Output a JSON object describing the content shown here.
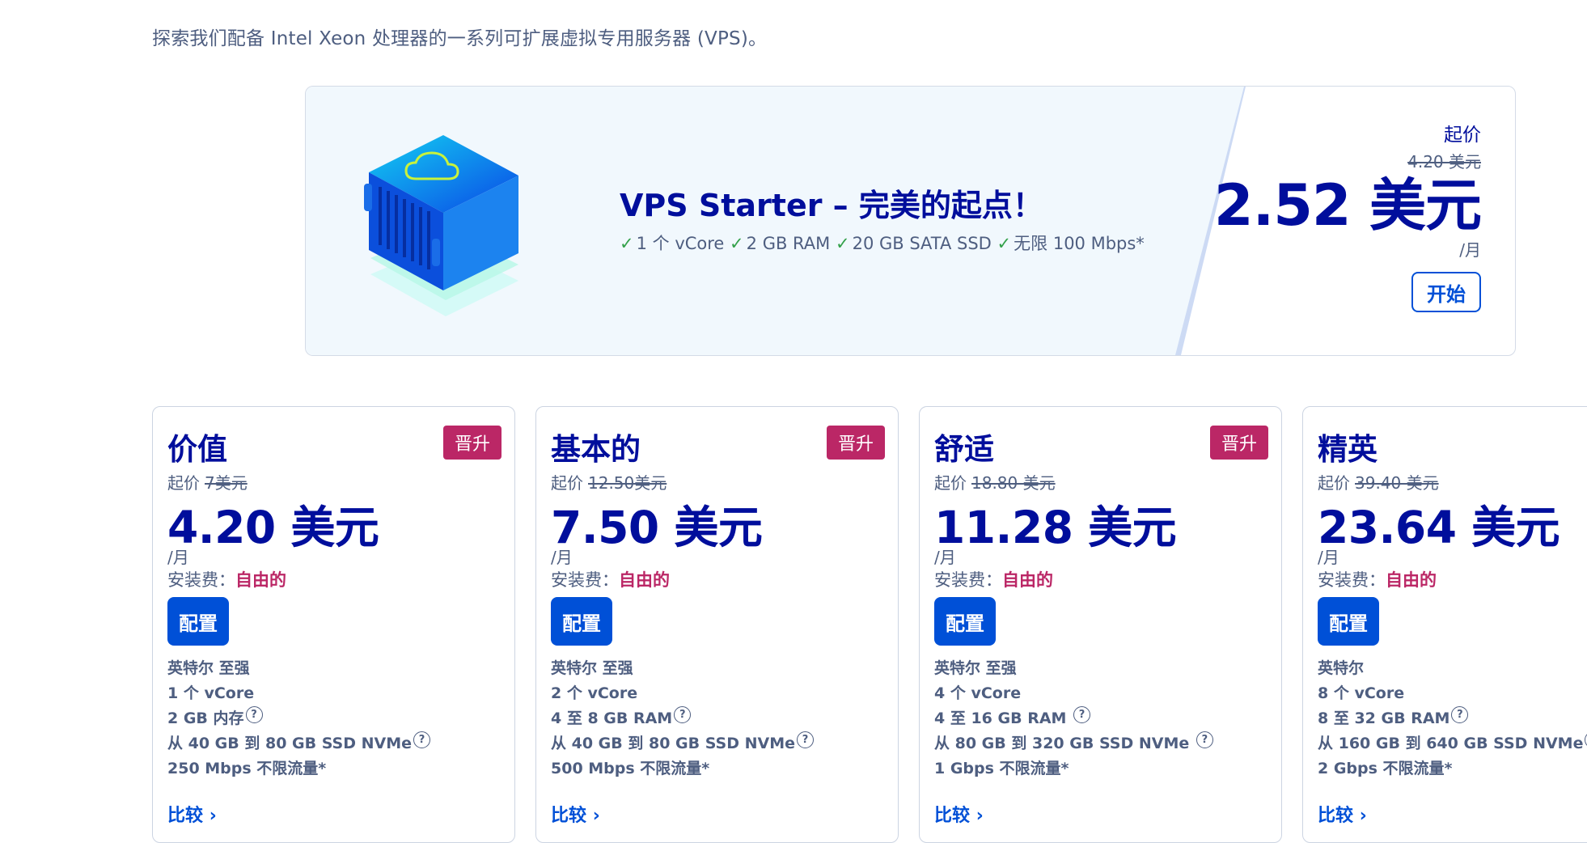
{
  "intro": "探索我们配备 Intel Xeon 处理器的一系列可扩展虚拟专用服务器 (VPS)。",
  "banner": {
    "title": "VPS Starter – 完美的起点！",
    "features": [
      "1 个 vCore",
      "2 GB RAM",
      "20 GB SATA SSD",
      "无限 100 Mbps*"
    ],
    "check_icon": "check-icon",
    "from_label": "起价",
    "old_price": "4.20 美元",
    "price": "2.52 美元",
    "unit": "/月",
    "button": "开始"
  },
  "plans": [
    {
      "name": "价值",
      "badge": "晋升",
      "from_label": "起价",
      "old_price": "7美元",
      "price": "4.20 美元",
      "unit": "/月",
      "setup_label": "安装费：",
      "setup_value": "自由的",
      "button": "配置",
      "specs": [
        "英特尔 至强",
        "1 个 vCore",
        "2 GB 内存",
        "从 40 GB 到 80 GB SSD NVMe",
        "250 Mbps 不限流量*"
      ],
      "compare": "比较"
    },
    {
      "name": "基本的",
      "badge": "晋升",
      "from_label": "起价",
      "old_price": "12.50美元",
      "price": "7.50 美元",
      "unit": "/月",
      "setup_label": "安装费：",
      "setup_value": "自由的",
      "button": "配置",
      "specs": [
        "英特尔 至强",
        "2 个 vCore",
        "4 至 8 GB RAM",
        "从 40 GB 到 80 GB SSD NVMe",
        "500 Mbps 不限流量*"
      ],
      "compare": "比较"
    },
    {
      "name": "舒适",
      "badge": "晋升",
      "from_label": "起价",
      "old_price": "18.80 美元",
      "price": "11.28 美元",
      "unit": "/月",
      "setup_label": "安装费：",
      "setup_value": "自由的",
      "button": "配置",
      "specs": [
        "英特尔 至强",
        "4 个 vCore",
        "4 至 16 GB RAM",
        "从 80 GB 到 320 GB SSD NVMe",
        "1 Gbps 不限流量*"
      ],
      "compare": "比较"
    },
    {
      "name": "精英",
      "badge": "",
      "from_label": "起价",
      "old_price": "39.40 美元",
      "price": "23.64 美元",
      "unit": "/月",
      "setup_label": "安装费：",
      "setup_value": "自由的",
      "button": "配置",
      "specs": [
        "英特尔",
        "8 个 vCore",
        "8 至 32 GB RAM",
        "从 160 GB 到 640 GB SSD NVMe",
        "2 Gbps 不限流量*"
      ],
      "compare": "比较"
    }
  ],
  "help_icon": "?",
  "arrow_icon": "›",
  "colors": {
    "navy": "#000e9c",
    "primary": "#0050d7",
    "promo": "#bb2766",
    "text_muted": "#4e5e80",
    "check": "#33a14a",
    "banner_bg": "#f1f8fd"
  }
}
